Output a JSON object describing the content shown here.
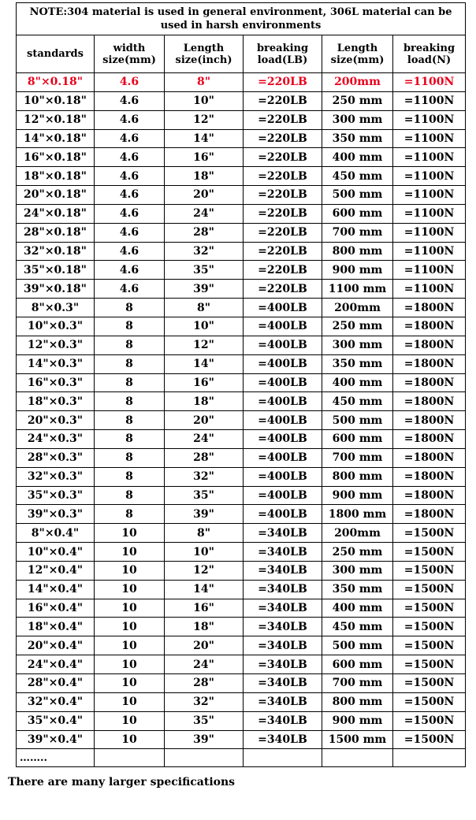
{
  "note": "NOTE:304 material is used in general environment, 306L material can be used in harsh environments",
  "headers": [
    "standards",
    "width size(mm)",
    "Length size(inch)",
    "breaking load(LB)",
    "Length size(mm)",
    "breaking load(N)"
  ],
  "highlight_color": "#e8001c",
  "rows": [
    [
      "8\"×0.18\"",
      "4.6",
      "8\"",
      "=220LB",
      "200mm",
      "=1100N"
    ],
    [
      "10\"×0.18\"",
      "4.6",
      "10\"",
      "=220LB",
      "250 mm",
      "=1100N"
    ],
    [
      "12\"×0.18\"",
      "4.6",
      "12\"",
      "=220LB",
      "300 mm",
      "=1100N"
    ],
    [
      "14\"×0.18\"",
      "4.6",
      "14\"",
      "=220LB",
      "350 mm",
      "=1100N"
    ],
    [
      "16\"×0.18\"",
      "4.6",
      "16\"",
      "=220LB",
      "400 mm",
      "=1100N"
    ],
    [
      "18\"×0.18\"",
      "4.6",
      "18\"",
      "=220LB",
      "450 mm",
      "=1100N"
    ],
    [
      "20\"×0.18\"",
      "4.6",
      "20\"",
      "=220LB",
      "500 mm",
      "=1100N"
    ],
    [
      "24\"×0.18\"",
      "4.6",
      "24\"",
      "=220LB",
      "600 mm",
      "=1100N"
    ],
    [
      "28\"×0.18\"",
      "4.6",
      "28\"",
      "=220LB",
      "700 mm",
      "=1100N"
    ],
    [
      "32\"×0.18\"",
      "4.6",
      "32\"",
      "=220LB",
      "800 mm",
      "=1100N"
    ],
    [
      "35\"×0.18\"",
      "4.6",
      "35\"",
      "=220LB",
      "900 mm",
      "=1100N"
    ],
    [
      "39\"×0.18\"",
      "4.6",
      "39\"",
      "=220LB",
      "1100 mm",
      "=1100N"
    ],
    [
      "8\"×0.3\"",
      "8",
      "8\"",
      "=400LB",
      "200mm",
      "=1800N"
    ],
    [
      "10\"×0.3\"",
      "8",
      "10\"",
      "=400LB",
      "250 mm",
      "=1800N"
    ],
    [
      "12\"×0.3\"",
      "8",
      "12\"",
      "=400LB",
      "300 mm",
      "=1800N"
    ],
    [
      "14\"×0.3\"",
      "8",
      "14\"",
      "=400LB",
      "350 mm",
      "=1800N"
    ],
    [
      "16\"×0.3\"",
      "8",
      "16\"",
      "=400LB",
      "400 mm",
      "=1800N"
    ],
    [
      "18\"×0.3\"",
      "8",
      "18\"",
      "=400LB",
      "450 mm",
      "=1800N"
    ],
    [
      "20\"×0.3\"",
      "8",
      "20\"",
      "=400LB",
      "500 mm",
      "=1800N"
    ],
    [
      "24\"×0.3\"",
      "8",
      "24\"",
      "=400LB",
      "600 mm",
      "=1800N"
    ],
    [
      "28\"×0.3\"",
      "8",
      "28\"",
      "=400LB",
      "700 mm",
      "=1800N"
    ],
    [
      "32\"×0.3\"",
      "8",
      "32\"",
      "=400LB",
      "800 mm",
      "=1800N"
    ],
    [
      "35\"×0.3\"",
      "8",
      "35\"",
      "=400LB",
      "900 mm",
      "=1800N"
    ],
    [
      "39\"×0.3\"",
      "8",
      "39\"",
      "=400LB",
      "1800 mm",
      "=1800N"
    ],
    [
      "8\"×0.4\"",
      "10",
      "8\"",
      "=340LB",
      "200mm",
      "=1500N"
    ],
    [
      "10\"×0.4\"",
      "10",
      "10\"",
      "=340LB",
      "250 mm",
      "=1500N"
    ],
    [
      "12\"×0.4\"",
      "10",
      "12\"",
      "=340LB",
      "300 mm",
      "=1500N"
    ],
    [
      "14\"×0.4\"",
      "10",
      "14\"",
      "=340LB",
      "350 mm",
      "=1500N"
    ],
    [
      "16\"×0.4\"",
      "10",
      "16\"",
      "=340LB",
      "400 mm",
      "=1500N"
    ],
    [
      "18\"×0.4\"",
      "10",
      "18\"",
      "=340LB",
      "450 mm",
      "=1500N"
    ],
    [
      "20\"×0.4\"",
      "10",
      "20\"",
      "=340LB",
      "500 mm",
      "=1500N"
    ],
    [
      "24\"×0.4\"",
      "10",
      "24\"",
      "=340LB",
      "600 mm",
      "=1500N"
    ],
    [
      "28\"×0.4\"",
      "10",
      "28\"",
      "=340LB",
      "700 mm",
      "=1500N"
    ],
    [
      "32\"×0.4\"",
      "10",
      "32\"",
      "=340LB",
      "800 mm",
      "=1500N"
    ],
    [
      "35\"×0.4\"",
      "10",
      "35\"",
      "=340LB",
      "900 mm",
      "=1500N"
    ],
    [
      "39\"×0.4\"",
      "10",
      "39\"",
      "=340LB",
      "1500 mm",
      "=1500N"
    ]
  ],
  "ellipsis": "……..",
  "footer": "There are many larger specifications"
}
